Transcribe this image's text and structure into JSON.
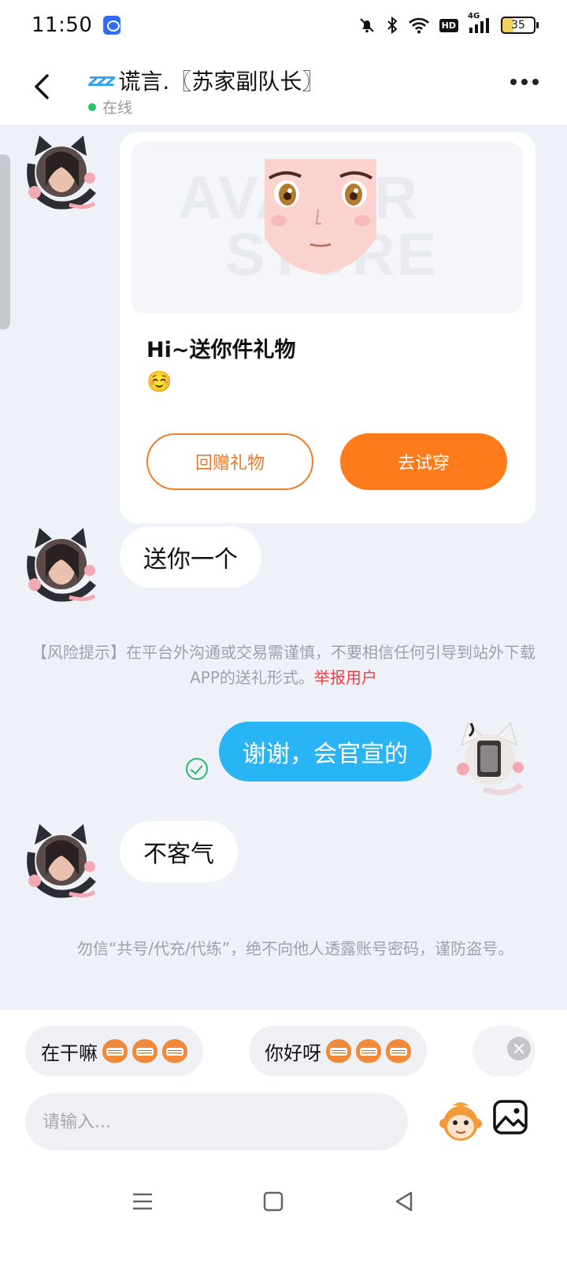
{
  "status_bar": {
    "time": "11:50",
    "battery_level": "35",
    "network_label": "4G",
    "hd_label": "HD"
  },
  "header": {
    "title": "谎言.〖苏家副队长〗",
    "status": "在线",
    "status_color": "#27c266",
    "zzz": "zzz"
  },
  "gift_card": {
    "watermark_line1": "AVATAR",
    "watermark_line2": "STORE",
    "title": "Hi~送你件礼物",
    "emoji": "☺️",
    "return_button": "回赠礼物",
    "try_button": "去试穿"
  },
  "messages": [
    {
      "direction": "in",
      "text": "送你一个"
    },
    {
      "direction": "out",
      "text": "谢谢，会官宣的",
      "status": "sent"
    },
    {
      "direction": "in",
      "text": "不客气"
    }
  ],
  "notices": {
    "risk_text": "【风险提示】在平台外沟通或交易需谨慎，不要相信任何引导到站外下载APP的送礼形式。",
    "report_link": "举报用户",
    "account_text": "勿信“共号/代充/代练”，绝不向他人透露账号密码，谨防盗号。"
  },
  "quick_replies": [
    {
      "label": "在干嘛"
    },
    {
      "label": "你好呀"
    }
  ],
  "input": {
    "placeholder": "请输入..."
  },
  "colors": {
    "accent_orange": "#ff7a1a",
    "bubble_blue": "#29b5f5",
    "report_red": "#ee3f3f",
    "background": "#eef2f8"
  },
  "icons": {
    "back": "chevron-left-icon",
    "more": "more-dots-icon",
    "emoji": "monkey-emoji-icon",
    "image": "image-icon",
    "nav_menu": "menu-icon",
    "nav_home": "home-square-icon",
    "nav_back": "triangle-back-icon"
  }
}
